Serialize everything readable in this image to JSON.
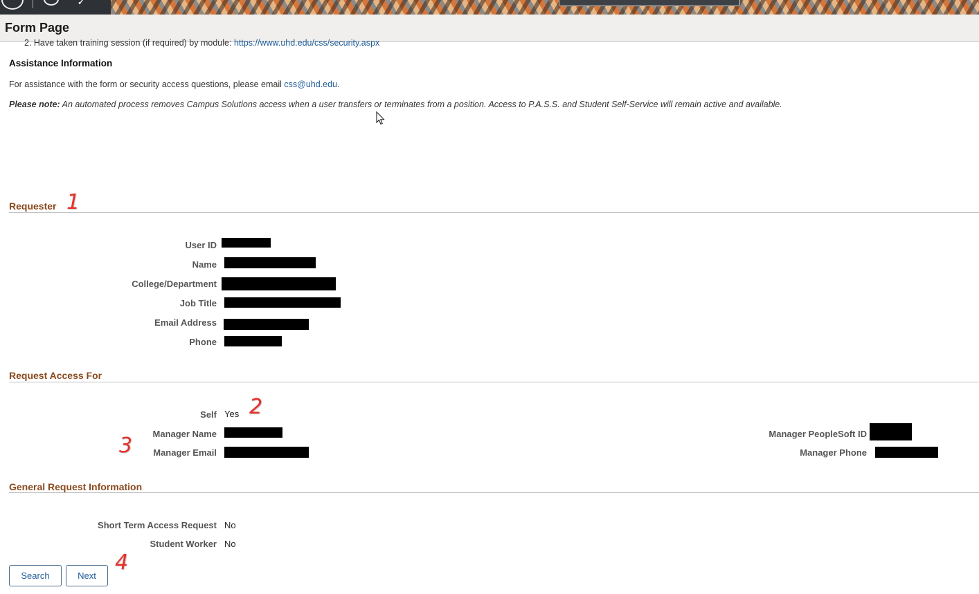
{
  "header": {
    "title": "Form Page"
  },
  "intro": {
    "clipped_line_text": "2. Have taken training session (if required) by module: ",
    "clipped_line_link": "https://www.uhd.edu/css/security.aspx"
  },
  "assistance": {
    "title": "Assistance Information",
    "text": "For assistance with the form or security access questions, please email ",
    "email_link": "css@uhd.edu",
    "email_suffix": ".",
    "note_label": "Please note:",
    "note_text": " An automated process removes Campus Solutions access when a user transfers or terminates from a position. Access to P.A.S.S. and Student Self-Service will remain active and available."
  },
  "requester": {
    "title": "Requester",
    "fields": {
      "user_id": "User ID",
      "name": "Name",
      "college": "College/Department",
      "job_title": "Job Title",
      "email": "Email Address",
      "phone": "Phone"
    }
  },
  "request_access": {
    "title": "Request Access For",
    "self_label": "Self",
    "self_value": "Yes",
    "manager_name": "Manager Name",
    "manager_email": "Manager Email",
    "manager_psid": "Manager PeopleSoft ID",
    "manager_phone": "Manager Phone"
  },
  "general": {
    "title": "General Request Information",
    "short_term_label": "Short Term Access Request",
    "short_term_value": "No",
    "student_worker_label": "Student Worker",
    "student_worker_value": "No"
  },
  "buttons": {
    "search": "Search",
    "next": "Next"
  },
  "markers": {
    "m1": "1",
    "m2": "2",
    "m3": "3",
    "m4": "4"
  },
  "colors": {
    "section_title": "#8a4a1e",
    "link": "#1f5d99",
    "marker": "#e8302a"
  }
}
